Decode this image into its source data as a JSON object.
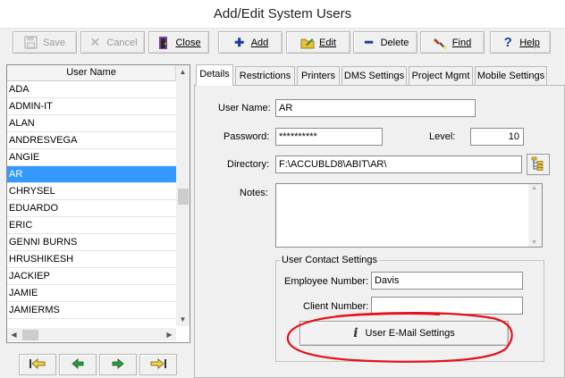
{
  "window": {
    "title": "Add/Edit System Users"
  },
  "toolbar": {
    "save": "Save",
    "cancel": "Cancel",
    "close": "Close",
    "add": "Add",
    "edit": "Edit",
    "delete": "Delete",
    "find": "Find",
    "help": "Help"
  },
  "user_list": {
    "header": "User Name",
    "selected": "AR",
    "items": [
      "ADA",
      "ADMIN-IT",
      "ALAN",
      "ANDRESVEGA",
      "ANGIE",
      "AR",
      "CHRYSEL",
      "EDUARDO",
      "ERIC",
      "GENNI BURNS",
      "HRUSHIKESH",
      "JACKIEP",
      "JAMIE",
      "JAMIERMS"
    ]
  },
  "tabs": [
    "Details",
    "Restrictions",
    "Printers",
    "DMS Settings",
    "Project Mgmt",
    "Mobile Settings"
  ],
  "details": {
    "user_name_label": "User Name:",
    "user_name_value": "AR",
    "password_label": "Password:",
    "password_value": "**********",
    "level_label": "Level:",
    "level_value": "10",
    "directory_label": "Directory:",
    "directory_value": "F:\\ACCUBLD8\\ABIT\\AR\\",
    "notes_label": "Notes:",
    "notes_value": "",
    "contact_group_label": "User Contact Settings",
    "employee_number_label": "Employee Number:",
    "employee_number_value": "Davis",
    "client_number_label": "Client Number:",
    "client_number_value": "",
    "email_button_label": "User E-Mail Settings"
  },
  "colors": {
    "selection": "#3399ff",
    "annotation": "#e3121b"
  }
}
